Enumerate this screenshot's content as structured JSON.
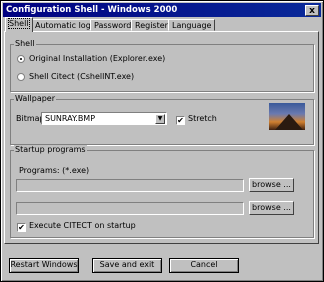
{
  "window": {
    "title": "Configuration Shell  -  Windows 2000",
    "close_glyph": "x"
  },
  "tabs": [
    {
      "label": "Shell",
      "active": true
    },
    {
      "label": "Automatic login"
    },
    {
      "label": "Password"
    },
    {
      "label": "Register"
    },
    {
      "label": "Language"
    }
  ],
  "shell": {
    "title": "Shell",
    "option1": "Original Installation (Explorer.exe)",
    "option2": "Shell Citect (CshellNT.exe)",
    "selected": "option1"
  },
  "wallpaper": {
    "title": "Wallpaper",
    "bitmap_label": "Bitmap:",
    "bitmap_value": "SUNRAY.BMP",
    "stretch_label": "Stretch",
    "stretch_checked": true,
    "dropdown_icon": "chevron-down-icon",
    "preview_icon": "wallpaper-preview-image"
  },
  "startup": {
    "title": "Startup programs",
    "programs_label": "Programs: (*.exe)",
    "program1": "",
    "program2": "",
    "browse1": "browse ...",
    "browse2": "browse ...",
    "execute_label": "Execute CITECT on startup",
    "execute_checked": true
  },
  "footer": {
    "restart": "Restart Windows",
    "save": "Save and exit",
    "cancel": "Cancel"
  },
  "check_glyph": "✔",
  "arrow_glyph": "▼"
}
